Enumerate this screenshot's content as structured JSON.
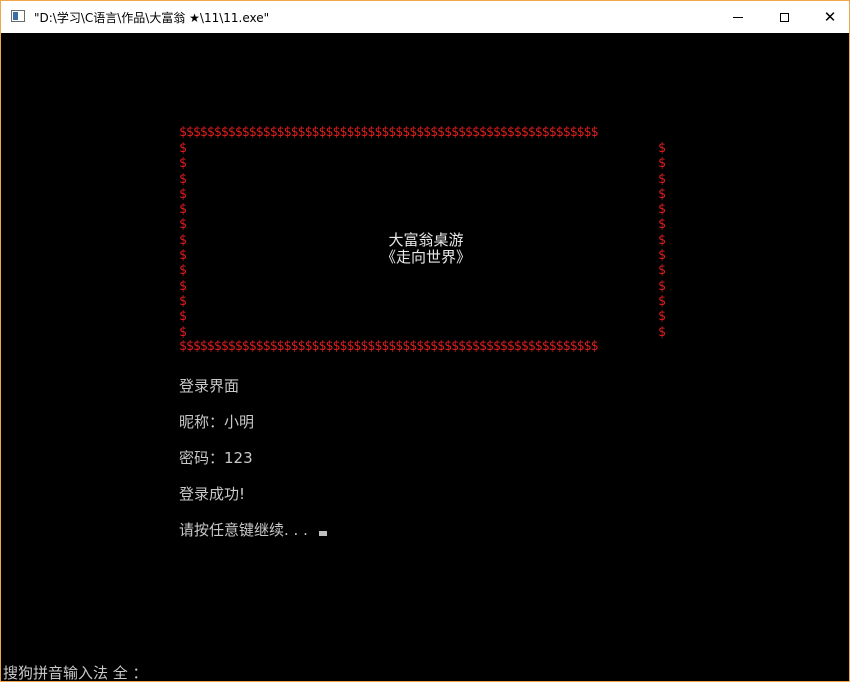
{
  "window": {
    "title": "\"D:\\学习\\C语言\\作品\\大富翁 ★\\11\\11.exe\"",
    "controls": {
      "minimize": "—",
      "maximize": "☐",
      "close": "✕"
    },
    "icon": "console-app-icon"
  },
  "console": {
    "frame": {
      "top_border": "$$$$$$$$$$$$$$$$$$$$$$$$$$$$$$$$$$$$$$$$$$$$$$$$$$$$$$$$$$$$",
      "bottom_border": "$$$$$$$$$$$$$$$$$$$$$$$$$$$$$$$$$$$$$$$$$$$$$$$$$$$$$$$$$$$$",
      "side_char": "$",
      "color": "#e01e1e"
    },
    "game_title_line1": "大富翁桌游",
    "game_title_line2": "《走向世界》",
    "login_header": "登录界面",
    "nickname_line": "昵称：小明",
    "password_line": "密码：123",
    "success_line": "登录成功!",
    "continue_prompt": "请按任意键继续. . . "
  },
  "ime_status": "搜狗拼音输入法 全 ："
}
